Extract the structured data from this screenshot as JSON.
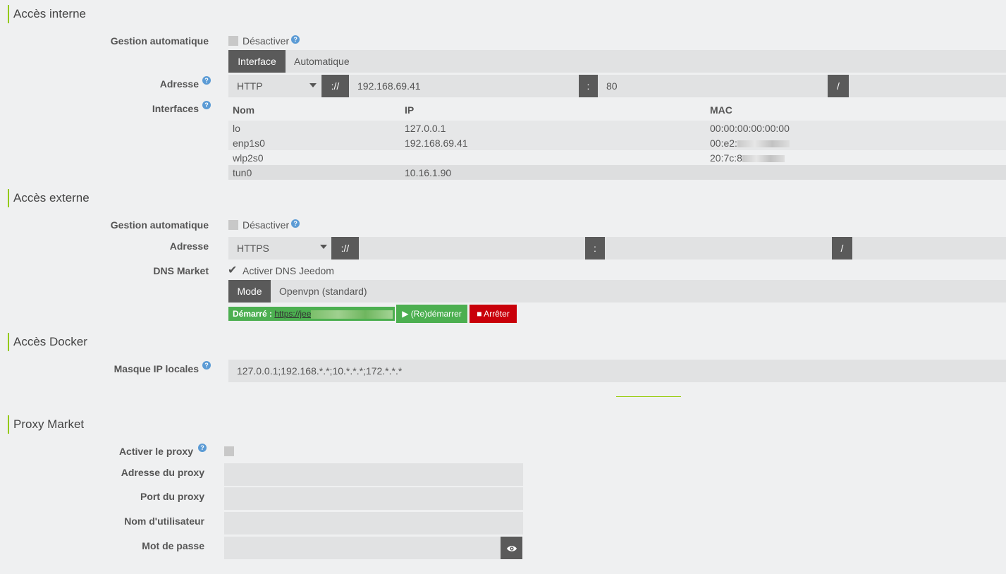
{
  "internal": {
    "title": "Accès interne",
    "auto_label": "Gestion automatique",
    "auto_checkbox_label": "Désactiver",
    "tab_interface": "Interface",
    "tab_value": "Automatique",
    "address_label": "Adresse",
    "protocol": "HTTP",
    "sep_scheme": "://",
    "ip": "192.168.69.41",
    "sep_port": ":",
    "port": "80",
    "sep_path": "/",
    "interfaces_label": "Interfaces",
    "table_headers": [
      "Nom",
      "IP",
      "MAC"
    ],
    "rows": [
      {
        "name": "lo",
        "ip": "127.0.0.1",
        "mac": "00:00:00:00:00:00"
      },
      {
        "name": "enp1s0",
        "ip": "192.168.69.41",
        "mac": "00:e2:"
      },
      {
        "name": "wlp2s0",
        "ip": "",
        "mac": "20:7c:8"
      },
      {
        "name": "tun0",
        "ip": "10.16.1.90",
        "mac": ""
      }
    ]
  },
  "external": {
    "title": "Accès externe",
    "auto_label": "Gestion automatique",
    "auto_checkbox_label": "Désactiver",
    "address_label": "Adresse",
    "protocol": "HTTPS",
    "sep_scheme": "://",
    "sep_port": ":",
    "sep_path": "/",
    "dns_label": "DNS Market",
    "dns_checkbox_label": "Activer DNS Jeedom",
    "mode_label": "Mode",
    "mode_value": "Openvpn (standard)",
    "status_label": "Démarré :",
    "status_link": "https://jee",
    "restart_button": "(Re)démarrer",
    "stop_button": "Arrêter"
  },
  "docker": {
    "title": "Accès Docker",
    "mask_label": "Masque IP locales",
    "mask_value": "127.0.0.1;192.168.*.*;10.*.*.*;172.*.*.*"
  },
  "proxy": {
    "title": "Proxy Market",
    "enable_label": "Activer le proxy",
    "address_label": "Adresse du proxy",
    "port_label": "Port du proxy",
    "user_label": "Nom d'utilisateur",
    "password_label": "Mot de passe"
  },
  "colors": {
    "accent": "#94ca02",
    "success": "#4caf50",
    "danger": "#c9000a",
    "dark": "#5a5a5a"
  }
}
